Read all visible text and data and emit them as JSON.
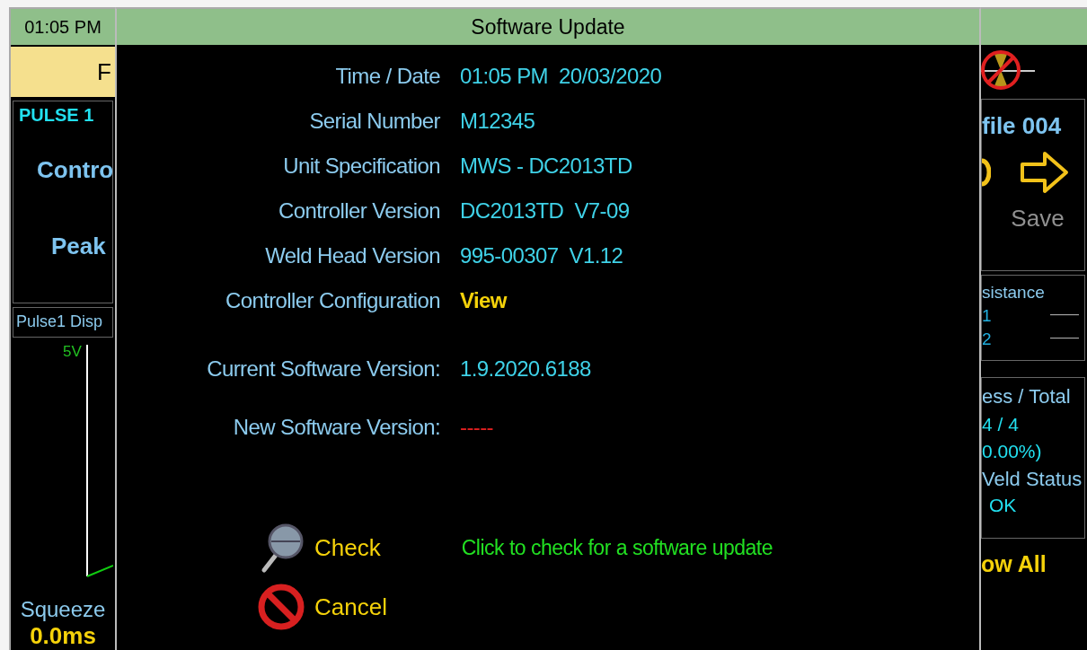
{
  "left_panel": {
    "time": "01:05 PM",
    "yellow_field": "F",
    "pulse_label": "PULSE 1",
    "control_label": "Contro",
    "peak_label": "Peak",
    "display_tab": "Pulse1 Disp",
    "axis_label": "5V",
    "squeeze_label": "Squeeze",
    "squeeze_value": "0.0ms"
  },
  "dialog": {
    "title": "Software Update",
    "rows": [
      {
        "label": "Time / Date",
        "value": "01:05 PM  20/03/2020",
        "kind": "text"
      },
      {
        "label": "Serial Number",
        "value": "M12345",
        "kind": "text"
      },
      {
        "label": "Unit Specification",
        "value": "MWS - DC2013TD",
        "kind": "text"
      },
      {
        "label": "Controller Version",
        "value": "DC2013TD  V7-09",
        "kind": "text"
      },
      {
        "label": "Weld Head Version",
        "value": "995-00307  V1.12",
        "kind": "text"
      },
      {
        "label": "Controller Configuration",
        "value": "View",
        "kind": "link"
      },
      {
        "label": "Current Software Version:",
        "value": "1.9.2020.6188",
        "kind": "version"
      },
      {
        "label": "New Software Version:",
        "value": "-----",
        "kind": "missing"
      }
    ],
    "check_button": "Check",
    "hint": "Click to check for a software update",
    "cancel_button": "Cancel"
  },
  "right_panel": {
    "profile_label": "file 004",
    "save_button": "Save",
    "resistance_label": "sistance",
    "resistance_rows": [
      {
        "index": "1",
        "value": "——"
      },
      {
        "index": "2",
        "value": "——"
      }
    ],
    "total_label": "ess / Total",
    "count": "4 / 4",
    "percent": "0.00%)",
    "status_label": "Veld Status",
    "status_value": "OK",
    "show_all": "ow All"
  }
}
